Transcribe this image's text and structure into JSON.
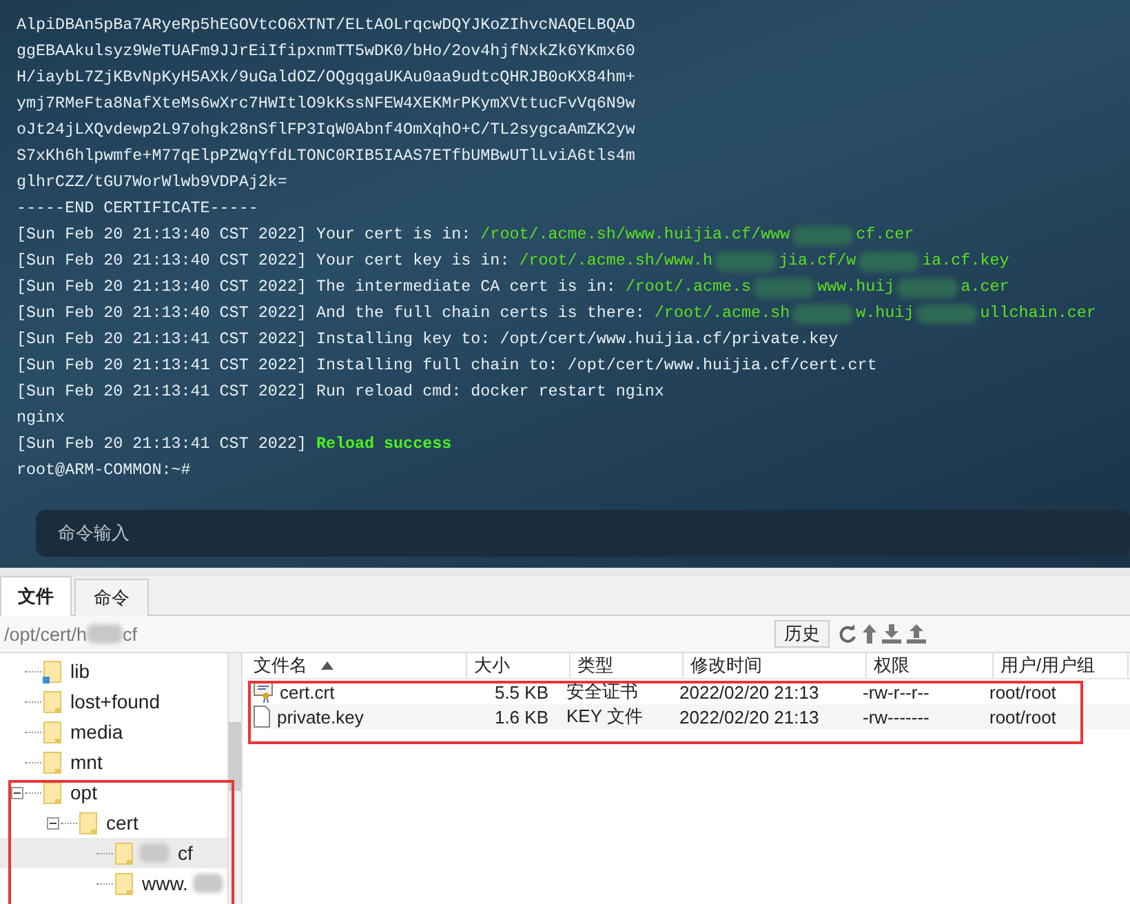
{
  "terminal": {
    "lines": [
      {
        "kind": "text",
        "text": "AlpiDBAn5pBa7ARyeRp5hEGOVtcO6XTNT/ELtAOLrqcwDQYJKoZIhvcNAQELBQAD"
      },
      {
        "kind": "text",
        "text": "ggEBAAkulsyz9WeTUAFm9JJrEiIfipxnmTT5wDK0/bHo/2ov4hjfNxkZk6YKmx60"
      },
      {
        "kind": "text",
        "text": "H/iaybL7ZjKBvNpKyH5AXk/9uGaldOZ/OQgqgaUKAu0aa9udtcQHRJB0oKX84hm+"
      },
      {
        "kind": "text",
        "text": "ymj7RMeFta8NafXteMs6wXrc7HWItlO9kKssNFEW4XEKMrPKymXVttucFvVq6N9w"
      },
      {
        "kind": "text",
        "text": "oJt24jLXQvdewp2L97ohgk28nSflFP3IqW0Abnf4OmXqhO+C/TL2sygcaAmZK2yw"
      },
      {
        "kind": "text",
        "text": "S7xKh6hlpwmfe+M77qElpPZWqYfdLTONC0RIB5IAAS7ETfbUMBwUTlLviA6tls4m"
      },
      {
        "kind": "text",
        "text": "glhrCZZ/tGU7WorWlwb9VDPAj2k="
      },
      {
        "kind": "text",
        "text": "-----END CERTIFICATE-----"
      },
      {
        "kind": "log",
        "time": "[Sun Feb 20 21:13:40 CST 2022]",
        "message": "Your cert is in:",
        "path": [
          "/root/.acme.sh/www.huijia.cf/www",
          "cf.cer"
        ]
      },
      {
        "kind": "log",
        "time": "[Sun Feb 20 21:13:40 CST 2022]",
        "message": "Your cert key is in:",
        "path": [
          "/root/.acme.sh/www.h",
          "jia.cf/w",
          "ia.cf.key"
        ]
      },
      {
        "kind": "log",
        "time": "[Sun Feb 20 21:13:40 CST 2022]",
        "message": "The intermediate CA cert is in:",
        "path": [
          "/root/.acme.s",
          "www.huij",
          "a.cer"
        ]
      },
      {
        "kind": "log",
        "time": "[Sun Feb 20 21:13:40 CST 2022]",
        "message": "And the full chain certs is there:",
        "path": [
          "/root/.acme.sh",
          "w.huij",
          "ullchain.cer"
        ]
      },
      {
        "kind": "log",
        "time": "[Sun Feb 20 21:13:41 CST 2022]",
        "message": "Installing key to: /opt/cert/www.huijia.cf/private.key"
      },
      {
        "kind": "log",
        "time": "[Sun Feb 20 21:13:41 CST 2022]",
        "message": "Installing full chain to: /opt/cert/www.huijia.cf/cert.crt"
      },
      {
        "kind": "log",
        "time": "[Sun Feb 20 21:13:41 CST 2022]",
        "message": "Run reload cmd: docker restart nginx"
      },
      {
        "kind": "text",
        "text": "nginx"
      },
      {
        "kind": "success",
        "time": "[Sun Feb 20 21:13:41 CST 2022]",
        "message": "Reload success"
      },
      {
        "kind": "text",
        "text": "root@ARM-COMMON:~#"
      }
    ],
    "command_input": {
      "placeholder": "命令输入"
    }
  },
  "tabs": [
    {
      "label": "文件",
      "selected": true
    },
    {
      "label": "命令",
      "selected": false
    }
  ],
  "path_bar": {
    "path": [
      "/opt/cert/h",
      "cf"
    ],
    "history_button": "历史"
  },
  "tree": [
    {
      "name": "lib",
      "kind": "link",
      "selected": false
    },
    {
      "name": "lost+found",
      "kind": "folder",
      "selected": false
    },
    {
      "name": "media",
      "kind": "folder",
      "selected": false
    },
    {
      "name": "mnt",
      "kind": "folder",
      "selected": false
    },
    {
      "name": "opt",
      "kind": "folder",
      "expanded": true,
      "selected": false,
      "children": [
        {
          "name": "cert",
          "kind": "folder",
          "expanded": true,
          "selected": false,
          "children": [
            {
              "name": "cf",
              "kind": "folder",
              "selected": true,
              "redacted_before": true,
              "redacted_after": false
            },
            {
              "name": "www.",
              "kind": "folder",
              "selected": false,
              "redacted_before": false,
              "redacted_after": true
            }
          ]
        }
      ]
    }
  ],
  "files": {
    "columns": [
      {
        "label": "文件名",
        "sorted": true
      },
      {
        "label": "大小",
        "sorted": false
      },
      {
        "label": "类型",
        "sorted": false
      },
      {
        "label": "修改时间",
        "sorted": false
      },
      {
        "label": "权限",
        "sorted": false
      },
      {
        "label": "用户/用户组",
        "sorted": false
      }
    ],
    "rows": [
      {
        "kind": "certificate",
        "name": "cert.crt",
        "size": "5.5 KB",
        "type": "安全证书",
        "modified": "2022/02/20 21:13",
        "permissions": "-rw-r--r--",
        "owner": "root/root"
      },
      {
        "kind": "file",
        "name": "private.key",
        "size": "1.6 KB",
        "type": "KEY 文件",
        "modified": "2022/02/20 21:13",
        "permissions": "-rw-------",
        "owner": "root/root"
      }
    ]
  }
}
